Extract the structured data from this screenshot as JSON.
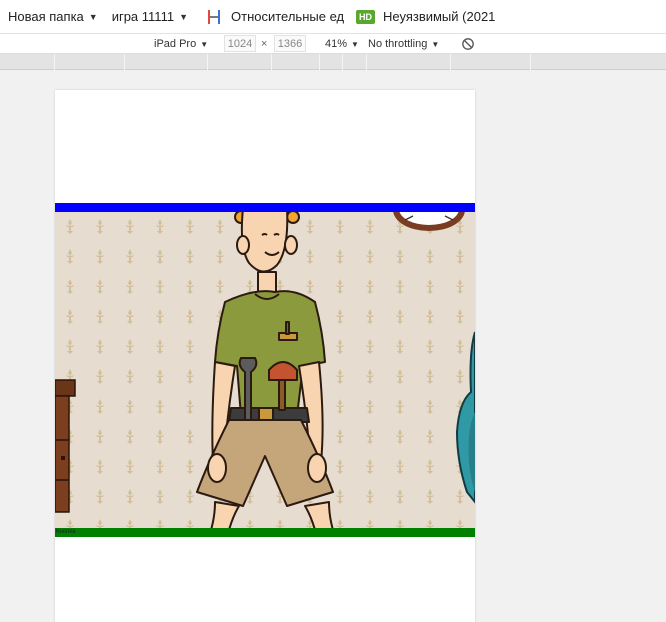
{
  "bookmarks": [
    {
      "label": "Новая папка",
      "has_caret": true
    },
    {
      "label": "игра 11111",
      "has_caret": true
    },
    {
      "label": "Относительные ед",
      "icon": "h-bookmark-icon"
    },
    {
      "label": "Неуязвимый (2021",
      "icon": "hd-badge",
      "badge": "HD"
    }
  ],
  "toolbar": {
    "device": "iPad Pro",
    "width": "1024",
    "times": "×",
    "height": "1366",
    "zoom": "41%",
    "throttling": "No throttling",
    "rotate_icon": "rotate-icon"
  },
  "page": {
    "bottom_label": "Кнопка",
    "colors": {
      "top_bar": "#0000ff",
      "bottom_bar": "#008000"
    }
  }
}
